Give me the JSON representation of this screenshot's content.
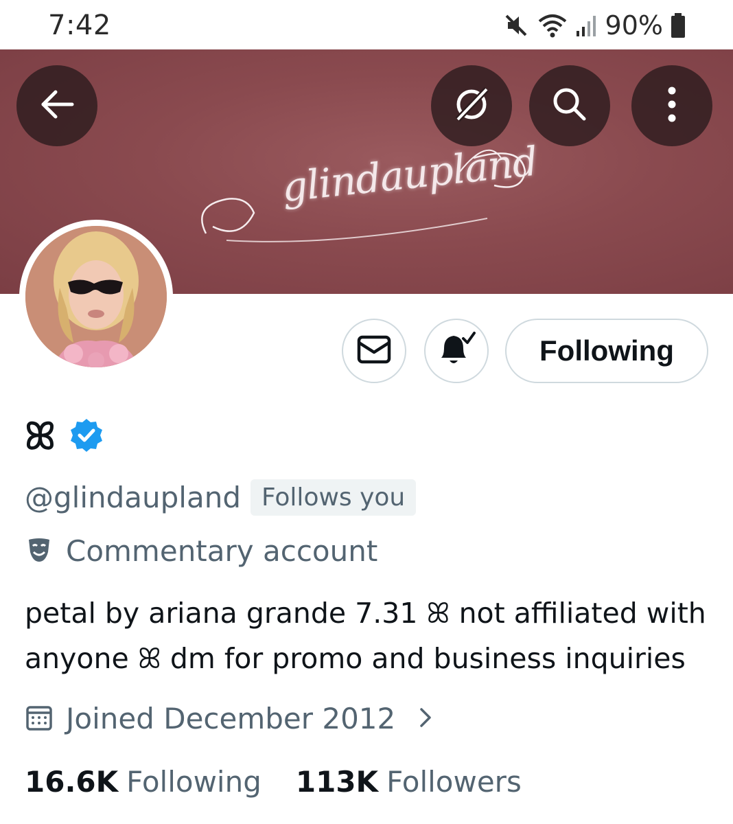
{
  "status_bar": {
    "time": "7:42",
    "battery": "90%",
    "icons": [
      "mute-icon",
      "wifi-icon",
      "signal-icon",
      "battery-icon"
    ]
  },
  "header": {
    "banner_text": "glindaupland",
    "back_icon": "arrow-left-icon",
    "grok_icon": "grok-icon",
    "search_icon": "search-icon",
    "more_icon": "more-vertical-icon"
  },
  "actions": {
    "message_icon": "envelope-icon",
    "notify_icon": "bell-check-icon",
    "following_label": "Following"
  },
  "profile": {
    "display_name": "ꕤ",
    "verified_icon": "verified-badge-icon",
    "handle": "@glindaupland",
    "follows_you": "Follows you",
    "category": "Commentary account",
    "bio_line1": "petal by ariana grande 7.31 ꕤ not affiliated with",
    "bio_line2": "anyone ꕤ dm for promo and business inquiries",
    "joined": "Joined December 2012"
  },
  "stats": {
    "following_count": "16.6K",
    "following_label": "Following",
    "followers_count": "113K",
    "followers_label": "Followers"
  },
  "colors": {
    "banner": "#8a4a4f",
    "text_primary": "#0f1419",
    "text_secondary": "#536471",
    "verified": "#1d9bf0",
    "border": "#cfd9de"
  }
}
